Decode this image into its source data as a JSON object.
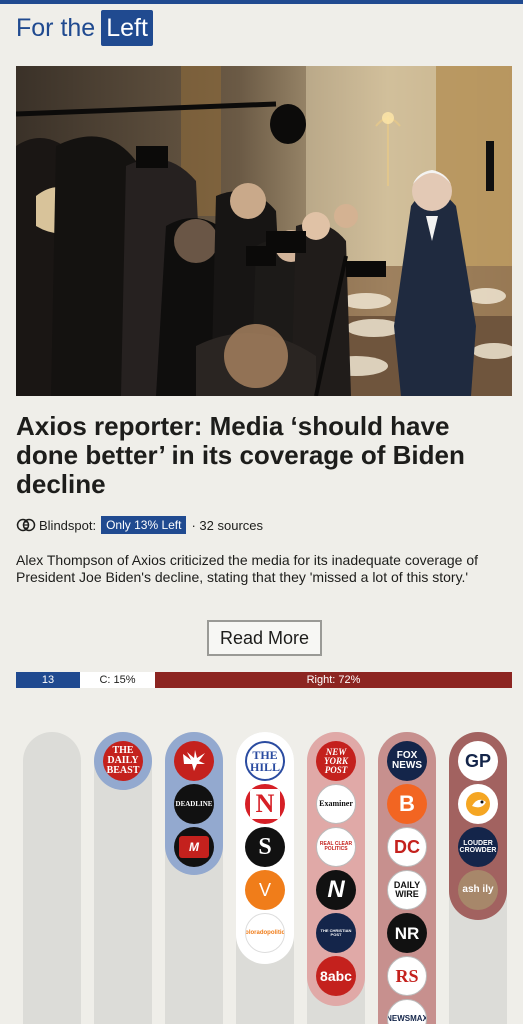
{
  "header": {
    "prefix": "For the",
    "tag": "Left"
  },
  "story": {
    "photo_icon": "press-gaggle-photo",
    "title": "Axios reporter: Media ‘should have done better’ in its coverage of Biden decline",
    "blindspot_label": "Blindspot:",
    "blindspot_badge": "Only 13% Left",
    "sources": "· 32 sources",
    "summary": "Alex Thompson of Axios criticized the media for its inadequate coverage of President Joe Biden's decline, stating that they 'missed a lot of this story.'",
    "read_more": "Read More"
  },
  "bias_bar": {
    "left_label": "13",
    "center_label": "C: 15%",
    "right_label": "Right: 72%",
    "left_pct": 13,
    "center_pct": 15,
    "right_pct": 72
  },
  "colors": {
    "left": "#204a90",
    "right": "#8c2521",
    "background": "#efeee9"
  },
  "outlets": {
    "far_left": [],
    "left": [
      {
        "name": "THE DAILY BEAST",
        "icon": "daily-beast-logo"
      }
    ],
    "lean_left": [
      {
        "name": "",
        "icon": "eagle-logo"
      },
      {
        "name": "DEADLINE",
        "icon": "deadline-logo"
      },
      {
        "name": "M",
        "icon": "m-logo"
      }
    ],
    "center": [
      {
        "name": "THE HILL",
        "icon": "the-hill-logo"
      },
      {
        "name": "N",
        "icon": "newsnation-logo"
      },
      {
        "name": "S",
        "icon": "s-logo"
      },
      {
        "name": "V",
        "icon": "v-logo"
      },
      {
        "name": "coloradopolitics",
        "icon": "colorado-politics-logo"
      }
    ],
    "lean_right": [
      {
        "name": "NEW YORK POST",
        "icon": "ny-post-logo"
      },
      {
        "name": "Examiner",
        "icon": "examiner-logo"
      },
      {
        "name": "REAL CLEAR POLITICS",
        "icon": "real-clear-politics-logo"
      },
      {
        "name": "N",
        "icon": "n-logo"
      },
      {
        "name": "THE CHRISTIAN POST",
        "icon": "christian-post-logo"
      },
      {
        "name": "8abc",
        "icon": "8abc-logo"
      }
    ],
    "right": [
      {
        "name": "FOX NEWS",
        "icon": "fox-news-logo"
      },
      {
        "name": "B",
        "icon": "breitbart-logo"
      },
      {
        "name": "DC",
        "icon": "daily-caller-logo"
      },
      {
        "name": "DAILY WIRE",
        "icon": "daily-wire-logo"
      },
      {
        "name": "NR",
        "icon": "national-review-logo"
      },
      {
        "name": "RS",
        "icon": "rs-logo"
      },
      {
        "name": "NEWSMAX",
        "icon": "newsmax-logo"
      }
    ],
    "far_right": [
      {
        "name": "GP",
        "icon": "gateway-pundit-logo"
      },
      {
        "name": "",
        "icon": "bird-logo"
      },
      {
        "name": "LOUDER CROWDER",
        "icon": "louder-crowder-logo"
      },
      {
        "name": "ash ily",
        "icon": "avatar-logo"
      }
    ]
  }
}
